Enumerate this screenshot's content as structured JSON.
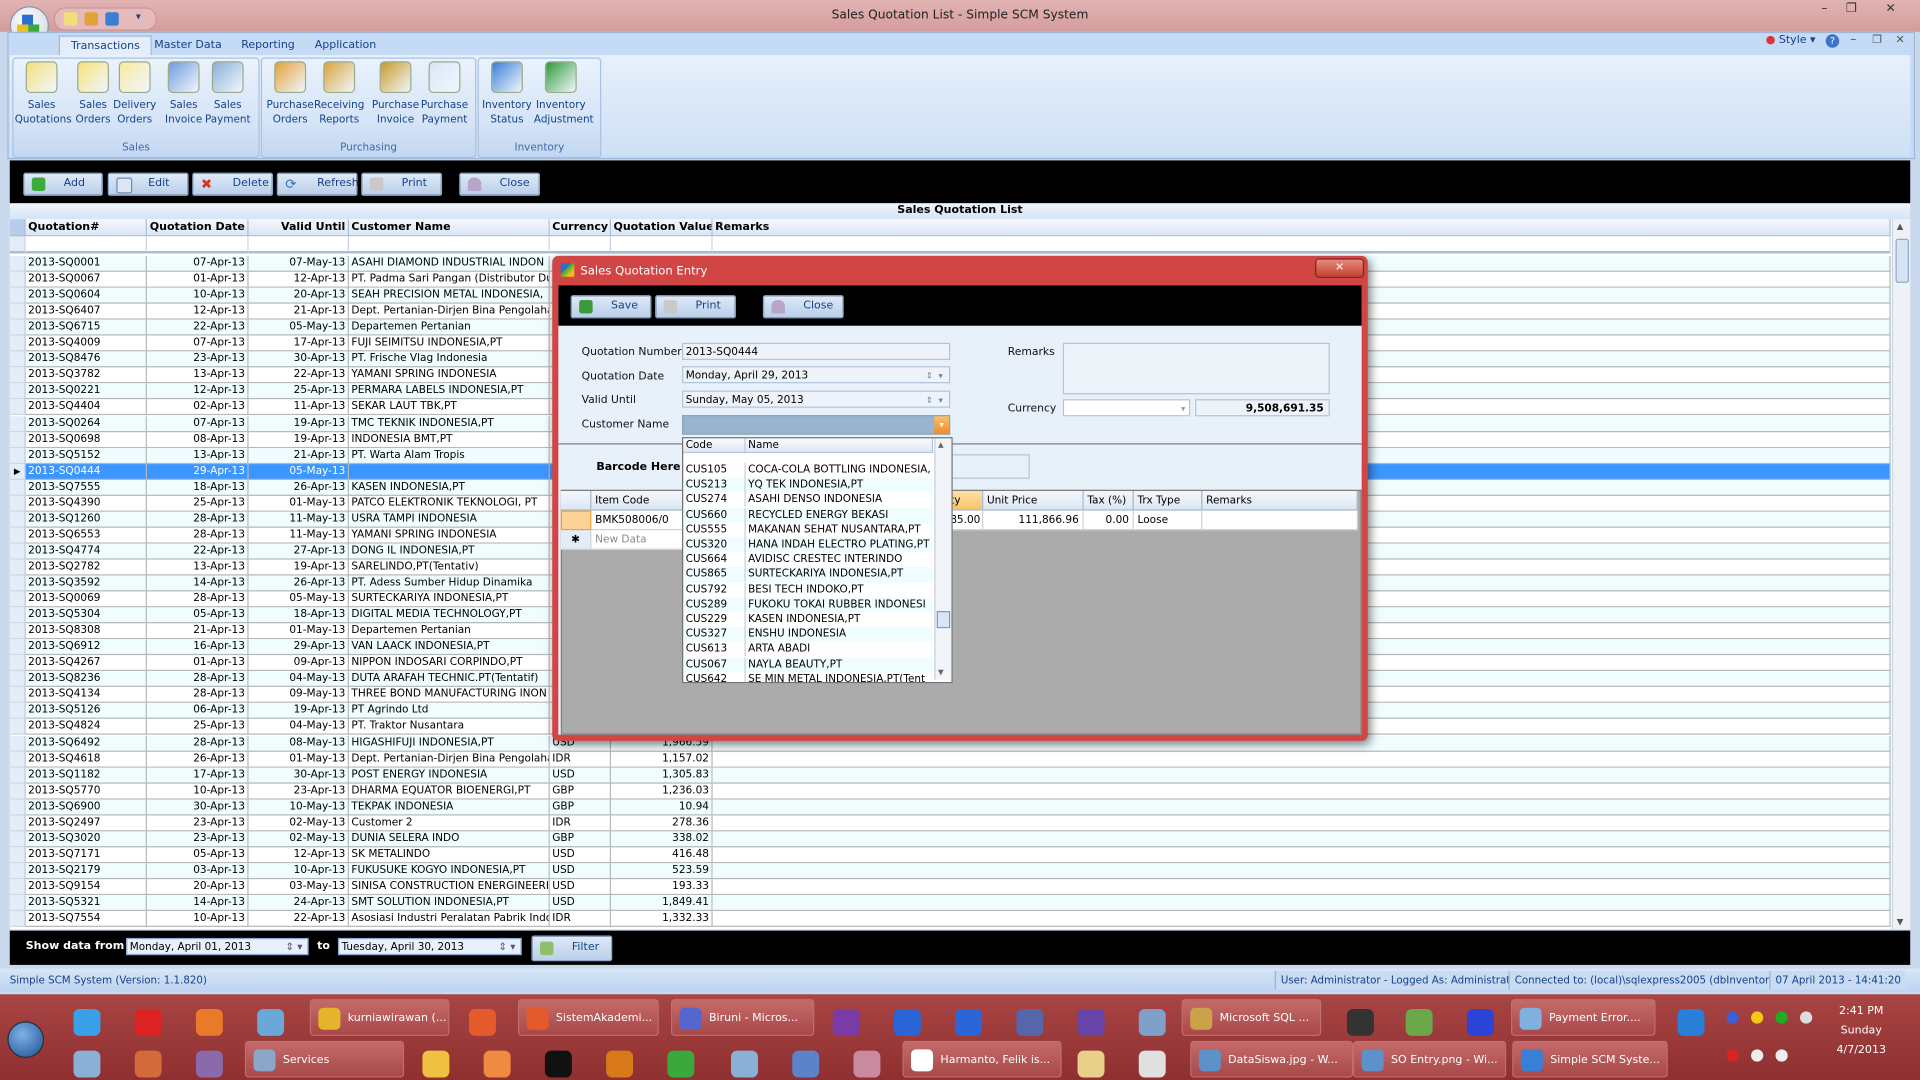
{
  "window": {
    "title": "Sales Quotation List - Simple SCM System"
  },
  "ribbon": {
    "tabs": [
      "Transactions",
      "Master Data",
      "Reporting",
      "Application"
    ],
    "style_label": "Style",
    "groups": [
      {
        "label": "Sales",
        "items": [
          [
            "Sales",
            "Quotations"
          ],
          [
            "Sales",
            "Orders"
          ],
          [
            "Delivery",
            "Orders"
          ],
          [
            "Sales",
            "Invoice"
          ],
          [
            "Sales",
            "Payment"
          ]
        ]
      },
      {
        "label": "Purchasing",
        "items": [
          [
            "Purchase",
            "Orders"
          ],
          [
            "Receiving",
            "Reports"
          ],
          [
            "Purchase",
            "Invoice"
          ],
          [
            "Purchase",
            "Payment"
          ]
        ]
      },
      {
        "label": "Inventory",
        "items": [
          [
            "Inventory",
            "Status"
          ],
          [
            "Inventory",
            "Adjustment"
          ]
        ]
      }
    ]
  },
  "toolbar": {
    "add": "Add",
    "edit": "Edit",
    "delete": "Delete",
    "refresh": "Refresh",
    "print": "Print",
    "close": "Close"
  },
  "grid": {
    "caption": "Sales Quotation List",
    "columns": [
      "Quotation#",
      "Quotation Date",
      "Valid Until",
      "Customer Name",
      "Currency",
      "Quotation Value",
      "Remarks"
    ],
    "selected_index": 13,
    "rows": [
      [
        "2013-SQ0001",
        "07-Apr-13",
        "07-May-13",
        "ASAHI DIAMOND INDUSTRIAL INDON",
        "",
        ""
      ],
      [
        "2013-SQ0067",
        "01-Apr-13",
        "12-Apr-13",
        "PT. Padma Sari Pangan (Distributor Du",
        "",
        ""
      ],
      [
        "2013-SQ0604",
        "10-Apr-13",
        "20-Apr-13",
        "SEAH PRECISION METAL INDONESIA,",
        "",
        ""
      ],
      [
        "2013-SQ6407",
        "12-Apr-13",
        "21-Apr-13",
        "Dept. Pertanian-Dirjen Bina Pengolaha",
        "",
        ""
      ],
      [
        "2013-SQ6715",
        "22-Apr-13",
        "05-May-13",
        "Departemen Pertanian",
        "",
        ""
      ],
      [
        "2013-SQ4009",
        "07-Apr-13",
        "17-Apr-13",
        "FUJI SEIMITSU INDONESIA,PT",
        "",
        ""
      ],
      [
        "2013-SQ8476",
        "23-Apr-13",
        "30-Apr-13",
        "PT. Frische Vlag Indonesia",
        "",
        ""
      ],
      [
        "2013-SQ3782",
        "13-Apr-13",
        "22-Apr-13",
        "YAMANI SPRING INDONESIA",
        "",
        ""
      ],
      [
        "2013-SQ0221",
        "12-Apr-13",
        "25-Apr-13",
        "PERMARA LABELS INDONESIA,PT",
        "",
        ""
      ],
      [
        "2013-SQ4404",
        "02-Apr-13",
        "11-Apr-13",
        "SEKAR LAUT TBK,PT",
        "",
        ""
      ],
      [
        "2013-SQ0264",
        "07-Apr-13",
        "19-Apr-13",
        "TMC TEKNIK INDONESIA,PT",
        "",
        ""
      ],
      [
        "2013-SQ0698",
        "08-Apr-13",
        "19-Apr-13",
        "INDONESIA BMT,PT",
        "",
        ""
      ],
      [
        "2013-SQ5152",
        "13-Apr-13",
        "21-Apr-13",
        "PT. Warta Alam Tropis",
        "",
        ""
      ],
      [
        "2013-SQ0444",
        "29-Apr-13",
        "05-May-13",
        "",
        "",
        ""
      ],
      [
        "2013-SQ7555",
        "18-Apr-13",
        "26-Apr-13",
        "KASEN INDONESIA,PT",
        "",
        ""
      ],
      [
        "2013-SQ4390",
        "25-Apr-13",
        "01-May-13",
        "PATCO ELEKTRONIK TEKNOLOGI, PT",
        "",
        ""
      ],
      [
        "2013-SQ1260",
        "28-Apr-13",
        "11-May-13",
        "USRA TAMPI INDONESIA",
        "",
        ""
      ],
      [
        "2013-SQ6553",
        "28-Apr-13",
        "11-May-13",
        "YAMANI SPRING INDONESIA",
        "",
        ""
      ],
      [
        "2013-SQ4774",
        "22-Apr-13",
        "27-Apr-13",
        "DONG IL INDONESIA,PT",
        "",
        ""
      ],
      [
        "2013-SQ2782",
        "13-Apr-13",
        "19-Apr-13",
        "SARELINDO,PT(Tentativ)",
        "",
        ""
      ],
      [
        "2013-SQ3592",
        "14-Apr-13",
        "26-Apr-13",
        "PT. Adess Sumber Hidup Dinamika",
        "",
        ""
      ],
      [
        "2013-SQ0069",
        "28-Apr-13",
        "05-May-13",
        "SURTECKARIYA INDONESIA,PT",
        "",
        ""
      ],
      [
        "2013-SQ5304",
        "05-Apr-13",
        "18-Apr-13",
        "DIGITAL MEDIA TECHNOLOGY,PT",
        "",
        ""
      ],
      [
        "2013-SQ8308",
        "21-Apr-13",
        "01-May-13",
        "Departemen Pertanian",
        "",
        ""
      ],
      [
        "2013-SQ6912",
        "16-Apr-13",
        "29-Apr-13",
        "VAN LAACK INDONESIA,PT",
        "",
        ""
      ],
      [
        "2013-SQ4267",
        "01-Apr-13",
        "09-Apr-13",
        "NIPPON INDOSARI CORPINDO,PT",
        "",
        ""
      ],
      [
        "2013-SQ8236",
        "28-Apr-13",
        "04-May-13",
        "DUTA ARAFAH TECHNIC.PT(Tentatif)",
        "",
        ""
      ],
      [
        "2013-SQ4134",
        "28-Apr-13",
        "09-May-13",
        "THREE BOND MANUFACTURING INON",
        "",
        ""
      ],
      [
        "2013-SQ5126",
        "06-Apr-13",
        "19-Apr-13",
        "PT Agrindo Ltd",
        "",
        ""
      ],
      [
        "2013-SQ4824",
        "25-Apr-13",
        "04-May-13",
        "PT. Traktor Nusantara",
        "",
        ""
      ],
      [
        "2013-SQ6492",
        "28-Apr-13",
        "08-May-13",
        "HIGASHIFUJI INDONESIA,PT",
        "USD",
        "1,966.59"
      ],
      [
        "2013-SQ4618",
        "26-Apr-13",
        "01-May-13",
        "Dept. Pertanian-Dirjen Bina Pengolaha",
        "IDR",
        "1,157.02"
      ],
      [
        "2013-SQ1182",
        "17-Apr-13",
        "30-Apr-13",
        "POST ENERGY INDONESIA",
        "USD",
        "1,305.83"
      ],
      [
        "2013-SQ5770",
        "10-Apr-13",
        "23-Apr-13",
        "DHARMA EQUATOR BIOENERGI,PT",
        "GBP",
        "1,236.03"
      ],
      [
        "2013-SQ6900",
        "30-Apr-13",
        "10-May-13",
        "TEKPAK INDONESIA",
        "GBP",
        "10.94"
      ],
      [
        "2013-SQ2497",
        "23-Apr-13",
        "02-May-13",
        "Customer 2",
        "IDR",
        "278.36"
      ],
      [
        "2013-SQ3020",
        "23-Apr-13",
        "02-May-13",
        "DUNIA SELERA INDO",
        "GBP",
        "338.02"
      ],
      [
        "2013-SQ7171",
        "05-Apr-13",
        "12-Apr-13",
        "SK METALINDO",
        "USD",
        "416.48"
      ],
      [
        "2013-SQ2179",
        "03-Apr-13",
        "10-Apr-13",
        "FUKUSUKE KOGYO INDONESIA,PT",
        "USD",
        "523.59"
      ],
      [
        "2013-SQ9154",
        "20-Apr-13",
        "03-May-13",
        "SINISA CONSTRUCTION ENERGINEERI",
        "USD",
        "193.33"
      ],
      [
        "2013-SQ5321",
        "14-Apr-13",
        "24-Apr-13",
        "SMT SOLUTION INDONESIA,PT",
        "USD",
        "1,849.41"
      ],
      [
        "2013-SQ7554",
        "10-Apr-13",
        "22-Apr-13",
        "Asosiasi Industri Peralatan Pabrik Indo",
        "IDR",
        "1,332.33"
      ]
    ]
  },
  "filter": {
    "show_from_label": "Show data from",
    "from": "Monday, April 01, 2013",
    "to_label": "to",
    "to": "Tuesday, April 30, 2013",
    "button": "Filter"
  },
  "status": {
    "version": "Simple SCM System (Version: 1.1.820)",
    "user": "User: Administrator - Logged As: Administrator",
    "connection": "Connected to: (local)\\sqlexpress2005 (dbInventory)",
    "datetime": "07 April 2013 - 14:41:20"
  },
  "dialog": {
    "title": "Sales Quotation Entry",
    "save": "Save",
    "print": "Print",
    "close": "Close",
    "labels": {
      "number": "Quotation Number",
      "date": "Quotation Date",
      "valid": "Valid Until",
      "customer": "Customer Name",
      "remarks": "Remarks",
      "currency": "Currency",
      "barcode": "Barcode Here"
    },
    "values": {
      "number": "2013-SQ0444",
      "date": "Monday, April 29, 2013",
      "valid": "Sunday, May 05, 2013",
      "customer": "",
      "currency": "",
      "total": "9,508,691.35"
    },
    "customer_dropdown": {
      "columns": [
        "Code",
        "Name"
      ],
      "rows": [
        [
          "CUS105",
          "COCA-COLA BOTTLING INDONESIA,"
        ],
        [
          "CUS213",
          "YQ TEK INDONESIA,PT"
        ],
        [
          "CUS274",
          "ASAHI DENSO INDONESIA"
        ],
        [
          "CUS660",
          "RECYCLED ENERGY BEKASI"
        ],
        [
          "CUS555",
          "MAKANAN SEHAT NUSANTARA,PT"
        ],
        [
          "CUS320",
          "HANA INDAH ELECTRO PLATING,PT"
        ],
        [
          "CUS664",
          "AVIDISC CRESTEC INTERINDO"
        ],
        [
          "CUS865",
          "SURTECKARIYA INDONESIA,PT"
        ],
        [
          "CUS792",
          "BESI TECH INDOKO,PT"
        ],
        [
          "CUS289",
          "FUKOKU TOKAI RUBBER INDONESI"
        ],
        [
          "CUS229",
          "KASEN INDONESIA,PT"
        ],
        [
          "CUS327",
          "ENSHU INDONESIA"
        ],
        [
          "CUS613",
          "ARTA ABADI"
        ],
        [
          "CUS067",
          "NAYLA BEAUTY,PT"
        ],
        [
          "CUS642",
          "SE MIN METAL INDONESIA,PT(Tent"
        ]
      ]
    },
    "detail": {
      "columns": [
        "Item Code",
        "ty",
        "Unit Price",
        "Tax (%)",
        "Trx Type",
        "Remarks"
      ],
      "row": {
        "item_code": "BMK508006/0",
        "qty": "85.00",
        "unit_price": "111,866.96",
        "tax": "0.00",
        "trx_type": "Loose"
      },
      "new_row": "New Data"
    }
  },
  "taskbar": {
    "top": [
      "kurniawirawan (...",
      "SistemAkademi...",
      "Biruni - Micros...",
      "Microsoft SQL ...",
      "Payment Error...."
    ],
    "bottom": [
      "Services",
      "Harmanto, Felik is...",
      "DataSiswa.jpg - W...",
      "SO Entry.png - Wi...",
      "Simple SCM Syste..."
    ],
    "clock": {
      "time": "2:41 PM",
      "day": "Sunday",
      "date": "4/7/2013"
    }
  },
  "colors": {
    "selection": "#3c96ff",
    "titlebar": "#d49c9c",
    "taskbar": "#9b3434",
    "dialog_frame": "#d24545",
    "ribbon": "#c5daf4"
  }
}
